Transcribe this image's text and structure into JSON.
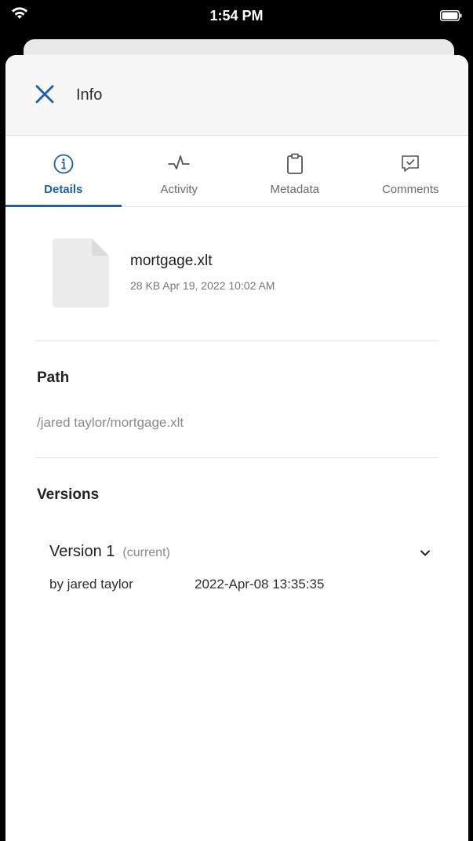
{
  "status_bar": {
    "time": "1:54 PM"
  },
  "header": {
    "title": "Info"
  },
  "tabs": [
    {
      "label": "Details",
      "icon": "info-icon",
      "active": true
    },
    {
      "label": "Activity",
      "icon": "activity-icon",
      "active": false
    },
    {
      "label": "Metadata",
      "icon": "clipboard-icon",
      "active": false
    },
    {
      "label": "Comments",
      "icon": "comment-check-icon",
      "active": false
    }
  ],
  "file": {
    "name": "mortgage.xlt",
    "meta": "28 KB Apr 19, 2022 10:02 AM"
  },
  "path": {
    "title": "Path",
    "value": "/jared taylor/mortgage.xlt"
  },
  "versions": {
    "title": "Versions",
    "items": [
      {
        "label": "Version 1",
        "status": "(current)",
        "author": "by jared taylor",
        "date": "2022-Apr-08 13:35:35"
      }
    ]
  },
  "colors": {
    "accent": "#1f5f9f",
    "header_bg": "#f7f7f8"
  }
}
